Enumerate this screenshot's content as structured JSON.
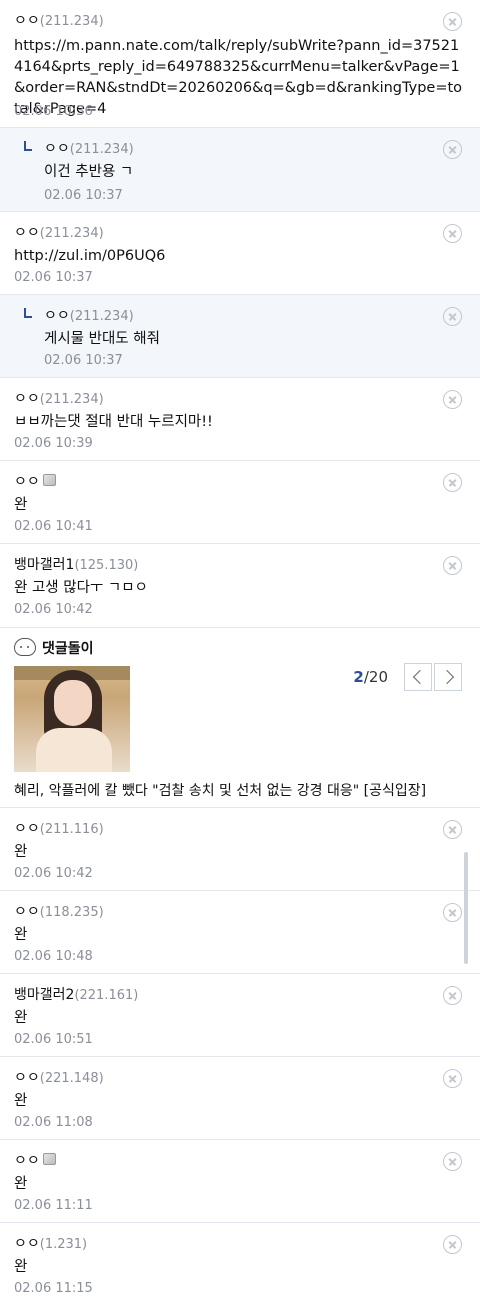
{
  "comments_top": [
    {
      "nick": "ㅇㅇ",
      "ip": "(211.234)",
      "body": "https://m.pann.nate.com/talk/reply/subWrite?pann_id=375214164&prts_reply_id=649788325&currMenu=talker&vPage=1&order=RAN&stndDt=20260206&q=&gb=d&rankingType=total&rPage=4",
      "date": "02.06 10:36"
    },
    {
      "nick": "ㅇㅇ",
      "ip": "(211.234)",
      "body": "이건 추반용 ㄱ",
      "date": "02.06 10:37"
    },
    {
      "nick": "ㅇㅇ",
      "ip": "(211.234)",
      "body": "http://zul.im/0P6UQ6",
      "date": "02.06 10:37"
    },
    {
      "nick": "ㅇㅇ",
      "ip": "(211.234)",
      "body": "게시물 반대도 해줘",
      "date": "02.06 10:37"
    },
    {
      "nick": "ㅇㅇ",
      "ip": "(211.234)",
      "body": "ㅂㅂ까는댓 절대 반대 누르지마!!",
      "date": "02.06 10:39"
    },
    {
      "nick": "ㅇㅇ",
      "ip": "",
      "body": "완",
      "date": "02.06 10:41"
    },
    {
      "nick": "뱅마갤러1",
      "ip": "(125.130)",
      "body": "완 고생 많다ㅜ ㄱㅁㅇ",
      "date": "02.06 10:42"
    }
  ],
  "banner": {
    "title": "댓글돌이",
    "page_current": "2",
    "page_total": "/20",
    "caption": "혜리, 악플러에 칼 뺐다 \"검찰 송치 및 선처 없는 강경 대응\" [공식입장]"
  },
  "comments_bottom": [
    {
      "nick": "ㅇㅇ",
      "ip": "(211.116)",
      "body": "완",
      "date": "02.06 10:42"
    },
    {
      "nick": "ㅇㅇ",
      "ip": "(118.235)",
      "body": "완",
      "date": "02.06 10:48"
    },
    {
      "nick": "뱅마갤러2",
      "ip": "(221.161)",
      "body": "완",
      "date": "02.06 10:51"
    },
    {
      "nick": "ㅇㅇ",
      "ip": "(221.148)",
      "body": "완",
      "date": "02.06 11:08"
    },
    {
      "nick": "ㅇㅇ",
      "ip": "",
      "body": "완",
      "date": "02.06 11:11"
    },
    {
      "nick": "ㅇㅇ",
      "ip": "(1.231)",
      "body": "완",
      "date": "02.06 11:15"
    }
  ]
}
